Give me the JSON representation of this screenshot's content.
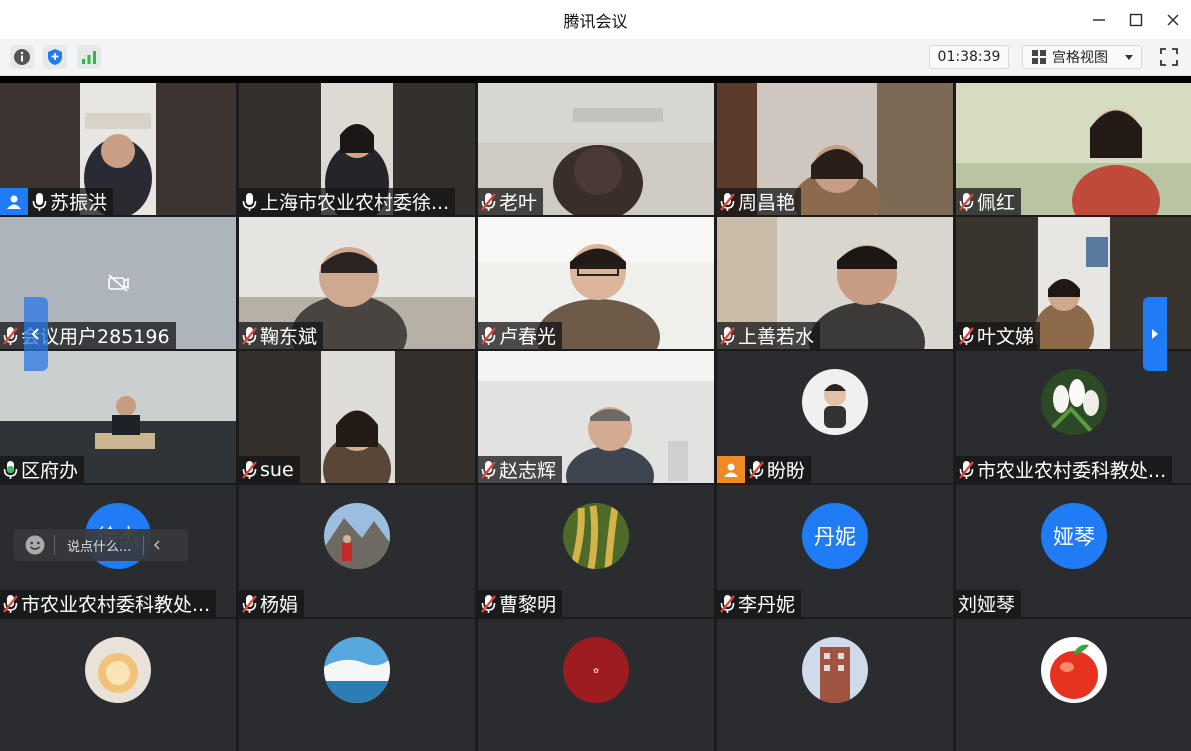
{
  "window": {
    "title": "腾讯会议"
  },
  "toolbar": {
    "timer": "01:38:39",
    "view_mode": "宫格视图"
  },
  "chat": {
    "placeholder": "说点什么..."
  },
  "colors": {
    "accent": "#1f7cf5",
    "muted_mic": "#e0453a",
    "active_mic": "#3cc25a"
  },
  "participants": [
    {
      "name": "苏振洪",
      "mic": "on",
      "badge": "user",
      "kind": "video"
    },
    {
      "name": "上海市农业农村委徐...",
      "mic": "on",
      "kind": "video"
    },
    {
      "name": "老叶",
      "mic": "muted",
      "kind": "video"
    },
    {
      "name": "周昌艳",
      "mic": "muted",
      "kind": "video"
    },
    {
      "name": "佩红",
      "mic": "muted",
      "kind": "video"
    },
    {
      "name": "会议用户285196",
      "mic": "muted",
      "kind": "camera-off"
    },
    {
      "name": "鞠东斌",
      "mic": "muted",
      "kind": "video"
    },
    {
      "name": "卢春光",
      "mic": "muted",
      "kind": "video"
    },
    {
      "name": "上善若水",
      "mic": "muted",
      "kind": "video"
    },
    {
      "name": "叶文娣",
      "mic": "muted",
      "kind": "video"
    },
    {
      "name": "区府办",
      "mic": "speaking",
      "kind": "video"
    },
    {
      "name": "sue",
      "mic": "muted",
      "kind": "video"
    },
    {
      "name": "赵志辉",
      "mic": "muted",
      "kind": "video"
    },
    {
      "name": "盼盼",
      "mic": "muted",
      "badge": "user-orange",
      "kind": "avatar-image"
    },
    {
      "name": "市农业农村委科教处...",
      "mic": "muted",
      "kind": "avatar-image"
    },
    {
      "name": "市农业农村委科教处...",
      "mic": "muted",
      "kind": "avatar-text",
      "avatar_text": "徐杰"
    },
    {
      "name": "杨娟",
      "mic": "muted",
      "kind": "avatar-image"
    },
    {
      "name": "曹黎明",
      "mic": "muted",
      "kind": "avatar-image"
    },
    {
      "name": "李丹妮",
      "mic": "muted",
      "kind": "avatar-text",
      "avatar_text": "丹妮"
    },
    {
      "name": "刘娅琴",
      "mic": "none",
      "kind": "avatar-text",
      "avatar_text": "娅琴"
    },
    {
      "kind": "avatar-image"
    },
    {
      "kind": "avatar-image"
    },
    {
      "kind": "avatar-image"
    },
    {
      "kind": "avatar-image"
    },
    {
      "kind": "avatar-image"
    }
  ]
}
